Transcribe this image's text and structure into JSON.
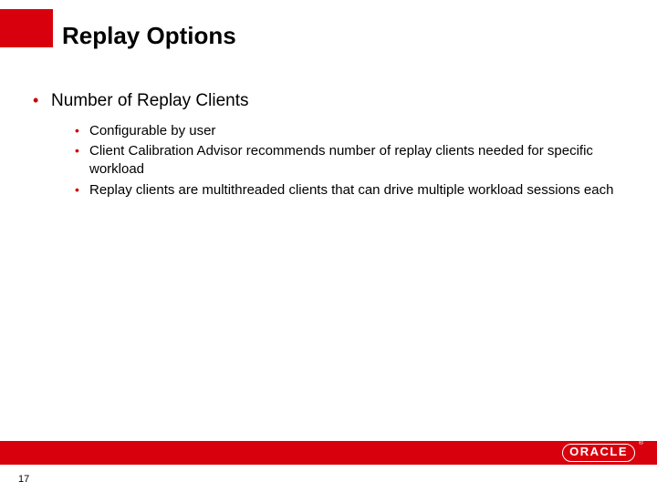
{
  "slide": {
    "title": "Replay Options",
    "level1": [
      {
        "text": "Number of Replay Clients"
      }
    ],
    "level2": [
      {
        "text": "Configurable by user"
      },
      {
        "text": "Client Calibration Advisor recommends number of replay clients needed for specific workload"
      },
      {
        "text": "Replay clients are multithreaded clients that can drive multiple workload sessions each"
      }
    ],
    "page_number": "17",
    "brand": "ORACLE",
    "brand_reg": "®"
  }
}
